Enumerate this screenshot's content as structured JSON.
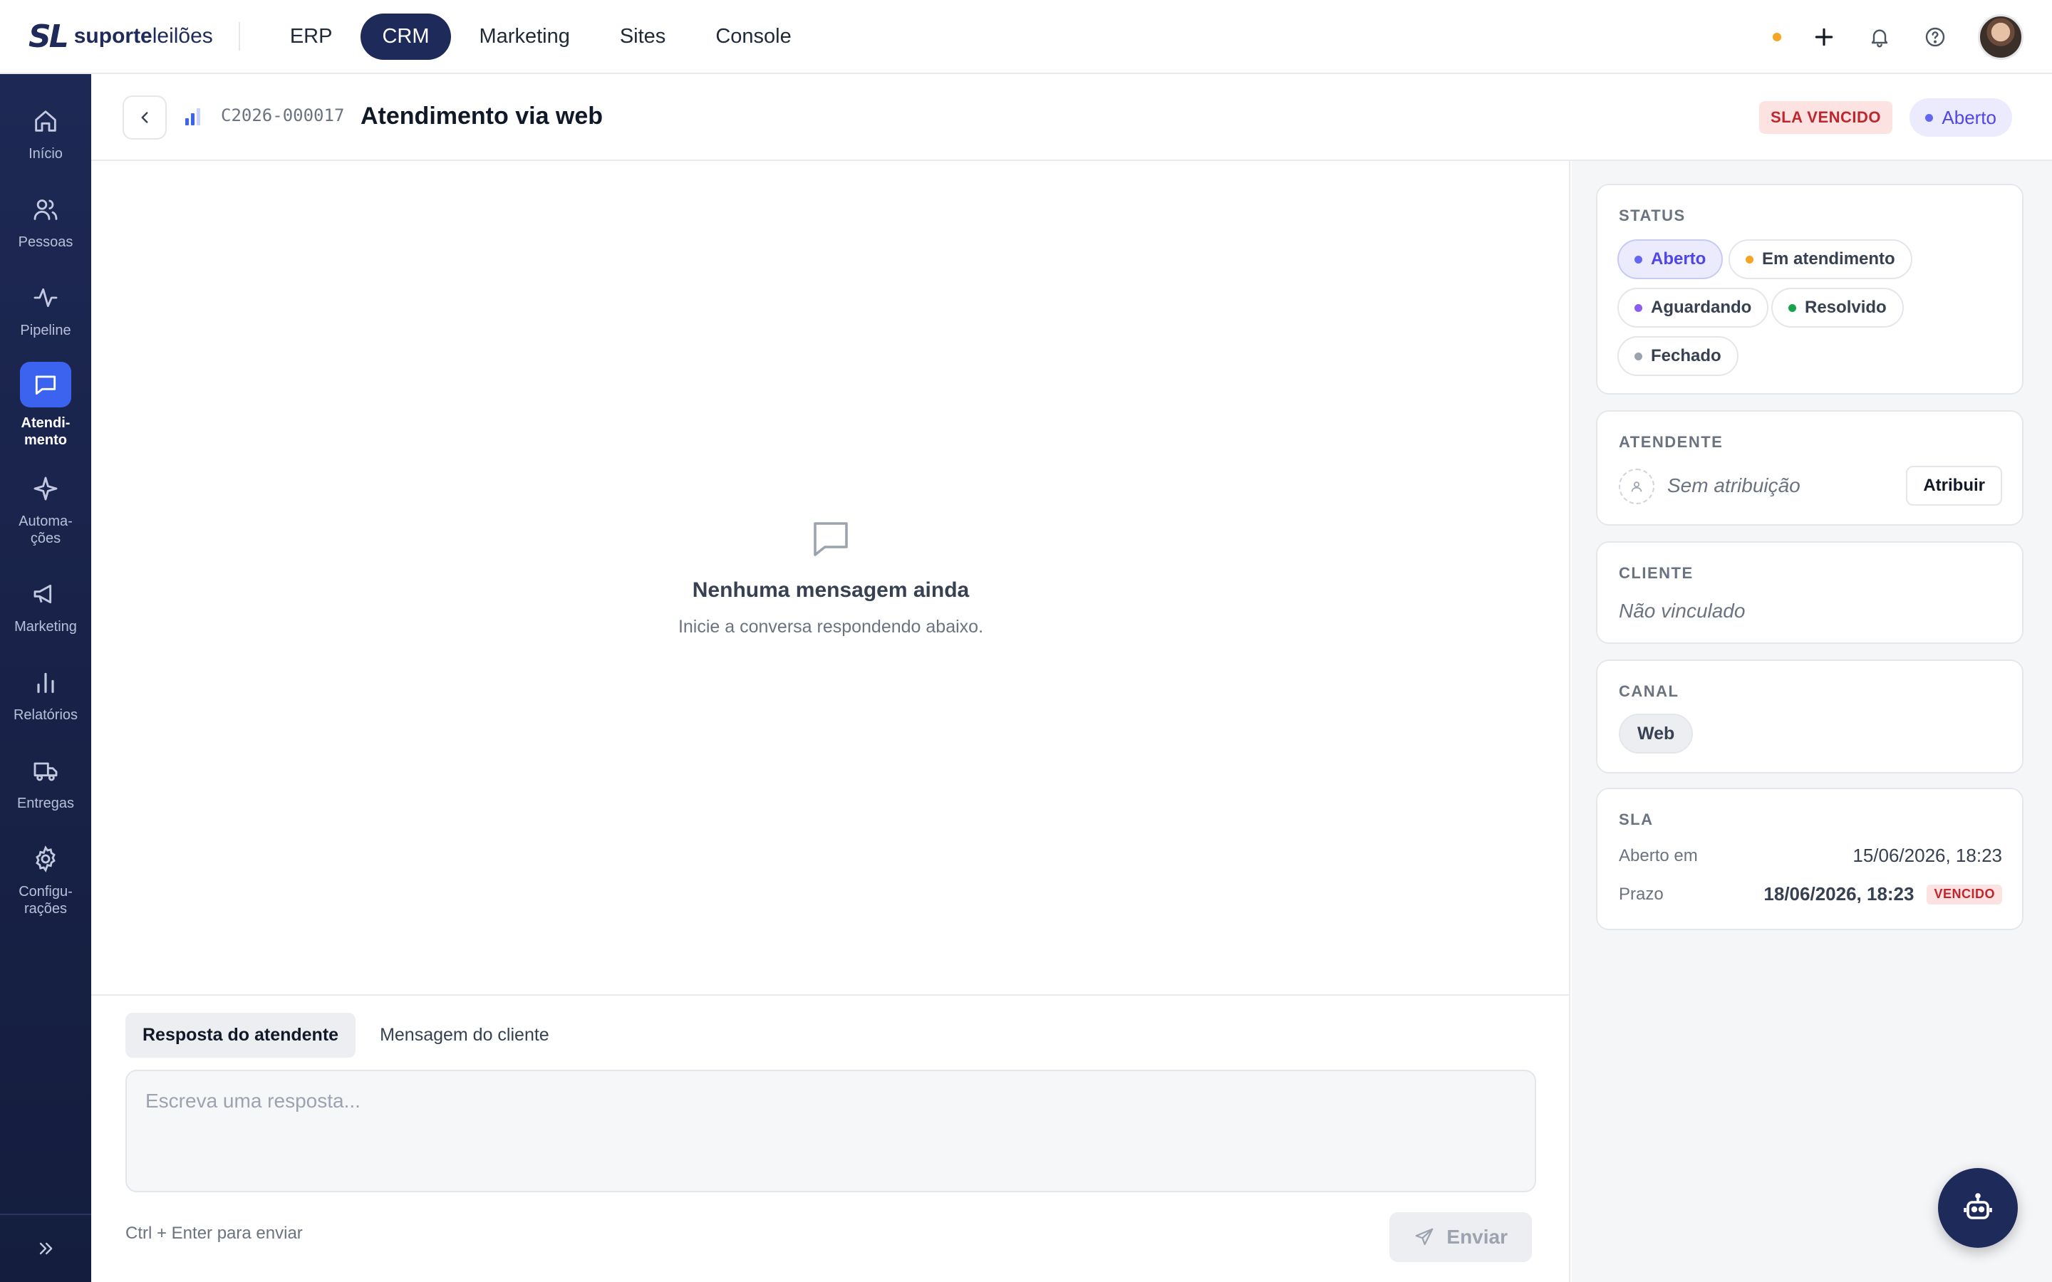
{
  "brand": {
    "mark": "SL",
    "name_bold": "suporte",
    "name_light": "leilões"
  },
  "topnav": [
    {
      "label": "ERP",
      "active": false
    },
    {
      "label": "CRM",
      "active": true
    },
    {
      "label": "Marketing",
      "active": false
    },
    {
      "label": "Sites",
      "active": false
    },
    {
      "label": "Console",
      "active": false
    }
  ],
  "topbar_icons": [
    "status-dot",
    "plus-icon",
    "bell-icon",
    "help-icon",
    "avatar"
  ],
  "sidebar": {
    "items": [
      {
        "label": "Início",
        "icon": "home-icon",
        "active": false
      },
      {
        "label": "Pessoas",
        "icon": "people-icon",
        "active": false
      },
      {
        "label": "Pipeline",
        "icon": "pipeline-icon",
        "active": false
      },
      {
        "label": "Atendi-\nmento",
        "icon": "chat-icon",
        "active": true
      },
      {
        "label": "Automa-\nções",
        "icon": "sparkle-icon",
        "active": false
      },
      {
        "label": "Marketing",
        "icon": "megaphone-icon",
        "active": false
      },
      {
        "label": "Relatórios",
        "icon": "bar-chart-icon",
        "active": false
      },
      {
        "label": "Entregas",
        "icon": "truck-icon",
        "active": false
      },
      {
        "label": "Configu-\nrações",
        "icon": "gear-icon",
        "active": false
      }
    ]
  },
  "ticket": {
    "code": "C2026-000017",
    "title": "Atendimento via web",
    "sla_badge": "SLA VENCIDO",
    "status_badge": "Aberto"
  },
  "conversation": {
    "empty_title": "Nenhuma mensagem ainda",
    "empty_subtitle": "Inicie a conversa respondendo abaixo."
  },
  "composer": {
    "tabs": [
      {
        "label": "Resposta do atendente",
        "active": true
      },
      {
        "label": "Mensagem do cliente",
        "active": false
      }
    ],
    "placeholder": "Escreva uma resposta...",
    "hint": "Ctrl + Enter para enviar",
    "send_label": "Enviar"
  },
  "panel": {
    "status": {
      "label": "STATUS",
      "options": [
        {
          "label": "Aberto",
          "color": "#6366f1",
          "selected": true
        },
        {
          "label": "Em atendimento",
          "color": "#f5a524",
          "selected": false
        },
        {
          "label": "Aguardando",
          "color": "#8b5cf6",
          "selected": false
        },
        {
          "label": "Resolvido",
          "color": "#16a34a",
          "selected": false
        },
        {
          "label": "Fechado",
          "color": "#9ca3af",
          "selected": false
        }
      ]
    },
    "attendant": {
      "label": "ATENDENTE",
      "value": "Sem atribuição",
      "button": "Atribuir"
    },
    "client": {
      "label": "CLIENTE",
      "value": "Não vinculado"
    },
    "channel": {
      "label": "CANAL",
      "value": "Web"
    },
    "sla": {
      "label": "SLA",
      "opened_label": "Aberto em",
      "opened_value": "15/06/2026, 18:23",
      "deadline_label": "Prazo",
      "deadline_value": "18/06/2026, 18:23",
      "deadline_badge": "VENCIDO"
    }
  },
  "colors": {
    "navy": "#1e2a5a",
    "accent": "#3b63f0",
    "danger": "#c0262d",
    "status_open": "#4f46e5"
  }
}
